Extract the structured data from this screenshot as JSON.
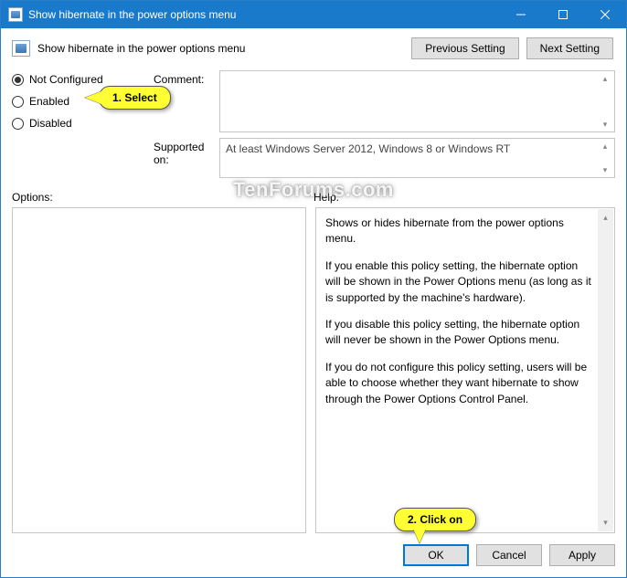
{
  "window": {
    "title": "Show hibernate in the power options menu"
  },
  "header": {
    "setting_name": "Show hibernate in the power options menu",
    "prev_btn": "Previous Setting",
    "next_btn": "Next Setting"
  },
  "state": {
    "options": [
      "Not Configured",
      "Enabled",
      "Disabled"
    ],
    "selected_index": 0
  },
  "labels": {
    "comment": "Comment:",
    "supported": "Supported on:",
    "options": "Options:",
    "help": "Help:"
  },
  "comment_value": "",
  "supported_value": "At least Windows Server 2012, Windows 8 or Windows RT",
  "help": {
    "p1": "Shows or hides hibernate from the power options menu.",
    "p2": "If you enable this policy setting, the hibernate option will be shown in the Power Options menu (as long as it is supported by the machine's hardware).",
    "p3": "If you disable this policy setting, the hibernate option will never be shown in the Power Options menu.",
    "p4": "If you do not configure this policy setting, users will be able to choose whether they want hibernate to show through the Power Options Control Panel."
  },
  "footer": {
    "ok": "OK",
    "cancel": "Cancel",
    "apply": "Apply"
  },
  "callouts": {
    "select": "1. Select",
    "click": "2. Click on"
  },
  "watermark": "TenForums.com"
}
